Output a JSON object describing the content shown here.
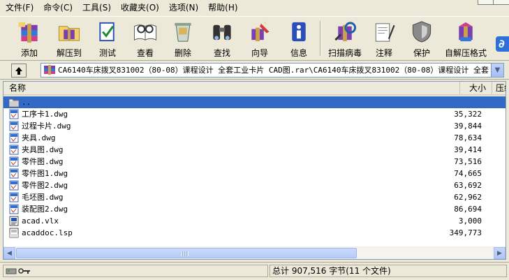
{
  "menu": [
    {
      "id": "file",
      "label": "文件(F)"
    },
    {
      "id": "commands",
      "label": "命令(C)"
    },
    {
      "id": "tools",
      "label": "工具(S)"
    },
    {
      "id": "favorites",
      "label": "收藏夹(O)"
    },
    {
      "id": "options",
      "label": "选项(N)"
    },
    {
      "id": "help",
      "label": "帮助(H)"
    }
  ],
  "toolbar": {
    "add": "添加",
    "extract_to": "解压到",
    "test": "测试",
    "view": "查看",
    "delete": "删除",
    "find": "查找",
    "wizard": "向导",
    "info": "信息",
    "virus_scan": "扫描病毒",
    "comment": "注释",
    "protect": "保护",
    "sfx": "自解压格式"
  },
  "address": {
    "path": "CA6140车床拨叉831002（80-08）课程设计 全套工业卡片 CAD图.rar\\CA6140车床拨叉831002（80-08）课程设计 全套"
  },
  "columns": {
    "name": "名称",
    "size": "大小",
    "ratio": "压缩"
  },
  "files": [
    {
      "name": "..",
      "size": "",
      "type": "parent",
      "selected": true
    },
    {
      "name": "工序卡1.dwg",
      "size": "35,322",
      "type": "dwg"
    },
    {
      "name": "过程卡片.dwg",
      "size": "39,844",
      "type": "dwg"
    },
    {
      "name": "夹具.dwg",
      "size": "78,634",
      "type": "dwg"
    },
    {
      "name": "夹具图.dwg",
      "size": "39,414",
      "type": "dwg"
    },
    {
      "name": "零件图.dwg",
      "size": "73,516",
      "type": "dwg"
    },
    {
      "name": "零件图1.dwg",
      "size": "74,665",
      "type": "dwg"
    },
    {
      "name": "零件图2.dwg",
      "size": "63,692",
      "type": "dwg"
    },
    {
      "name": "毛坯图.dwg",
      "size": "62,962",
      "type": "dwg"
    },
    {
      "name": "装配图2.dwg",
      "size": "86,694",
      "type": "dwg"
    },
    {
      "name": "acad.vlx",
      "size": "3,000",
      "type": "vlx"
    },
    {
      "name": "acaddoc.lsp",
      "size": "349,773",
      "type": "lsp"
    }
  ],
  "status": {
    "summary": "总计 907,516 字节(11 个文件)"
  },
  "colors": {
    "selection": "#316ac5",
    "window_bg": "#ece9d8",
    "list_border": "#7f9db9"
  }
}
